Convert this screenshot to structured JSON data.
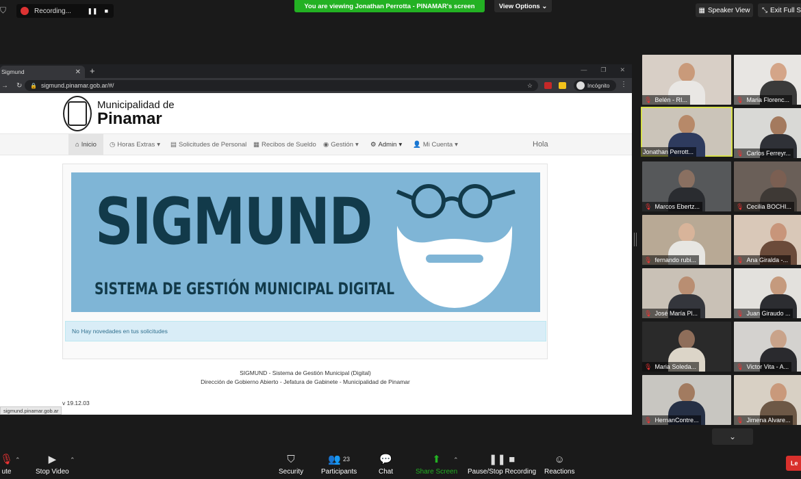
{
  "topbar": {
    "recording_label": "Recording...",
    "viewing_banner": "You are viewing Jonathan Perrotta - PINAMAR's screen",
    "view_options": "View Options",
    "speaker_view": "Speaker View",
    "exit_fullscreen": "Exit Full S"
  },
  "browser": {
    "tab_title": "Sigmund",
    "url": "sigmund.pinamar.gob.ar/#/",
    "incognito_label": "Incógnito",
    "status_url": "sigmund.pinamar.gob.ar"
  },
  "site": {
    "logo_line1": "Municipalidad de",
    "logo_line2": "Pinamar",
    "nav": {
      "inicio": "Inicio",
      "horas_extras": "Horas Extras",
      "solicitudes": "Solicitudes de Personal",
      "recibos": "Recibos de Sueldo",
      "gestion": "Gestión",
      "admin": "Admin",
      "mi_cuenta": "Mi Cuenta",
      "hola": "Hola"
    },
    "banner_title": "SIGMUND",
    "banner_subtitle": "SISTEMA DE GESTIÓN MUNICIPAL DIGITAL",
    "notice": "No Hay novedades en tus solicitudes",
    "footer_line1": "SIGMUND - Sistema de Gestión Municipal (Digital)",
    "footer_line2": "Dirección de Gobierno Abierto - Jefatura de Gabinete - Municipalidad de Pinamar",
    "version": "v 19.12.03"
  },
  "gallery": {
    "participants": [
      {
        "name": "Belén - RI..."
      },
      {
        "name": "Maria Florenc..."
      },
      {
        "name": "Jonathan Perrott..."
      },
      {
        "name": "Carlos Ferreyr..."
      },
      {
        "name": "Marcos Ebertz..."
      },
      {
        "name": "Cecilia BOCHI..."
      },
      {
        "name": "fernando rubi..."
      },
      {
        "name": "Ana Giralda -..."
      },
      {
        "name": "José María Pl..."
      },
      {
        "name": "Juan Giraudo ..."
      },
      {
        "name": "Maria Soleda..."
      },
      {
        "name": "Victor Vita - A..."
      },
      {
        "name": "HernanContre..."
      },
      {
        "name": "Jimena Alvare..."
      }
    ]
  },
  "toolbar": {
    "mute": "ute",
    "stop_video": "Stop Video",
    "security": "Security",
    "participants": "Participants",
    "participants_count": "23",
    "chat": "Chat",
    "share_screen": "Share Screen",
    "pause_recording": "Pause/Stop Recording",
    "reactions": "Reactions",
    "leave": "Le"
  }
}
